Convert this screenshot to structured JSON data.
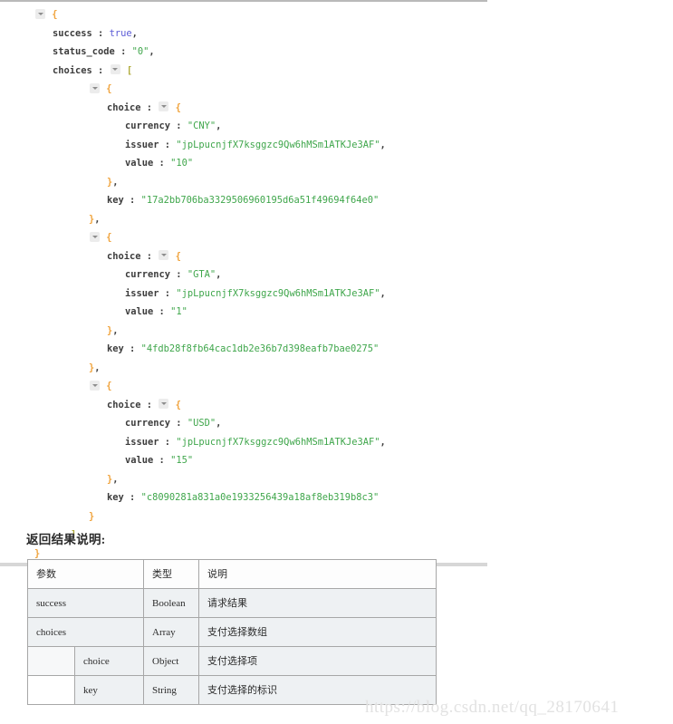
{
  "json_viewer": {
    "lines": [
      {
        "indent": 0,
        "toggle": true,
        "segments": [
          {
            "t": "brace",
            "v": "{"
          }
        ]
      },
      {
        "indent": 1,
        "toggle": false,
        "segments": [
          {
            "t": "k",
            "v": "success"
          },
          {
            "t": "colon",
            "v": " : "
          },
          {
            "t": "bool",
            "v": "true"
          },
          {
            "t": "punc",
            "v": ","
          }
        ]
      },
      {
        "indent": 1,
        "toggle": false,
        "segments": [
          {
            "t": "k",
            "v": "status_code"
          },
          {
            "t": "colon",
            "v": " : "
          },
          {
            "t": "str",
            "v": "\"0\""
          },
          {
            "t": "punc",
            "v": ","
          }
        ]
      },
      {
        "indent": 1,
        "toggle": false,
        "segments": [
          {
            "t": "k",
            "v": "choices"
          },
          {
            "t": "colon",
            "v": " : "
          },
          {
            "t": "tri"
          },
          {
            "t": "brack",
            "v": " ["
          }
        ]
      },
      {
        "indent": 3,
        "toggle": true,
        "segments": [
          {
            "t": "brace",
            "v": "{"
          }
        ]
      },
      {
        "indent": 4,
        "toggle": false,
        "segments": [
          {
            "t": "k",
            "v": "choice"
          },
          {
            "t": "colon",
            "v": " : "
          },
          {
            "t": "tri"
          },
          {
            "t": "brace",
            "v": " {"
          }
        ]
      },
      {
        "indent": 5,
        "toggle": false,
        "segments": [
          {
            "t": "k",
            "v": "currency"
          },
          {
            "t": "colon",
            "v": " : "
          },
          {
            "t": "str",
            "v": "\"CNY\""
          },
          {
            "t": "punc",
            "v": ","
          }
        ]
      },
      {
        "indent": 5,
        "toggle": false,
        "segments": [
          {
            "t": "k",
            "v": "issuer"
          },
          {
            "t": "colon",
            "v": " : "
          },
          {
            "t": "str",
            "v": "\"jpLpucnjfX7ksggzc9Qw6hMSm1ATKJe3AF\""
          },
          {
            "t": "punc",
            "v": ","
          }
        ]
      },
      {
        "indent": 5,
        "toggle": false,
        "segments": [
          {
            "t": "k",
            "v": "value"
          },
          {
            "t": "colon",
            "v": " : "
          },
          {
            "t": "str",
            "v": "\"10\""
          }
        ]
      },
      {
        "indent": 4,
        "toggle": false,
        "segments": [
          {
            "t": "brace",
            "v": "}"
          },
          {
            "t": "punc",
            "v": ","
          }
        ]
      },
      {
        "indent": 4,
        "toggle": false,
        "segments": [
          {
            "t": "k",
            "v": "key"
          },
          {
            "t": "colon",
            "v": " : "
          },
          {
            "t": "str",
            "v": "\"17a2bb706ba3329506960195d6a51f49694f64e0\""
          }
        ]
      },
      {
        "indent": 3,
        "toggle": false,
        "segments": [
          {
            "t": "brace",
            "v": "}"
          },
          {
            "t": "punc",
            "v": ","
          }
        ]
      },
      {
        "indent": 3,
        "toggle": true,
        "segments": [
          {
            "t": "brace",
            "v": "{"
          }
        ]
      },
      {
        "indent": 4,
        "toggle": false,
        "segments": [
          {
            "t": "k",
            "v": "choice"
          },
          {
            "t": "colon",
            "v": " : "
          },
          {
            "t": "tri"
          },
          {
            "t": "brace",
            "v": " {"
          }
        ]
      },
      {
        "indent": 5,
        "toggle": false,
        "segments": [
          {
            "t": "k",
            "v": "currency"
          },
          {
            "t": "colon",
            "v": " : "
          },
          {
            "t": "str",
            "v": "\"GTA\""
          },
          {
            "t": "punc",
            "v": ","
          }
        ]
      },
      {
        "indent": 5,
        "toggle": false,
        "segments": [
          {
            "t": "k",
            "v": "issuer"
          },
          {
            "t": "colon",
            "v": " : "
          },
          {
            "t": "str",
            "v": "\"jpLpucnjfX7ksggzc9Qw6hMSm1ATKJe3AF\""
          },
          {
            "t": "punc",
            "v": ","
          }
        ]
      },
      {
        "indent": 5,
        "toggle": false,
        "segments": [
          {
            "t": "k",
            "v": "value"
          },
          {
            "t": "colon",
            "v": " : "
          },
          {
            "t": "str",
            "v": "\"1\""
          }
        ]
      },
      {
        "indent": 4,
        "toggle": false,
        "segments": [
          {
            "t": "brace",
            "v": "}"
          },
          {
            "t": "punc",
            "v": ","
          }
        ]
      },
      {
        "indent": 4,
        "toggle": false,
        "segments": [
          {
            "t": "k",
            "v": "key"
          },
          {
            "t": "colon",
            "v": " : "
          },
          {
            "t": "str",
            "v": "\"4fdb28f8fb64cac1db2e36b7d398eafb7bae0275\""
          }
        ]
      },
      {
        "indent": 3,
        "toggle": false,
        "segments": [
          {
            "t": "brace",
            "v": "}"
          },
          {
            "t": "punc",
            "v": ","
          }
        ]
      },
      {
        "indent": 3,
        "toggle": true,
        "segments": [
          {
            "t": "brace",
            "v": "{"
          }
        ]
      },
      {
        "indent": 4,
        "toggle": false,
        "segments": [
          {
            "t": "k",
            "v": "choice"
          },
          {
            "t": "colon",
            "v": " : "
          },
          {
            "t": "tri"
          },
          {
            "t": "brace",
            "v": " {"
          }
        ]
      },
      {
        "indent": 5,
        "toggle": false,
        "segments": [
          {
            "t": "k",
            "v": "currency"
          },
          {
            "t": "colon",
            "v": " : "
          },
          {
            "t": "str",
            "v": "\"USD\""
          },
          {
            "t": "punc",
            "v": ","
          }
        ]
      },
      {
        "indent": 5,
        "toggle": false,
        "segments": [
          {
            "t": "k",
            "v": "issuer"
          },
          {
            "t": "colon",
            "v": " : "
          },
          {
            "t": "str",
            "v": "\"jpLpucnjfX7ksggzc9Qw6hMSm1ATKJe3AF\""
          },
          {
            "t": "punc",
            "v": ","
          }
        ]
      },
      {
        "indent": 5,
        "toggle": false,
        "segments": [
          {
            "t": "k",
            "v": "value"
          },
          {
            "t": "colon",
            "v": " : "
          },
          {
            "t": "str",
            "v": "\"15\""
          }
        ]
      },
      {
        "indent": 4,
        "toggle": false,
        "segments": [
          {
            "t": "brace",
            "v": "}"
          },
          {
            "t": "punc",
            "v": ","
          }
        ]
      },
      {
        "indent": 4,
        "toggle": false,
        "segments": [
          {
            "t": "k",
            "v": "key"
          },
          {
            "t": "colon",
            "v": " : "
          },
          {
            "t": "str",
            "v": "\"c8090281a831a0e1933256439a18af8eb319b8c3\""
          }
        ]
      },
      {
        "indent": 3,
        "toggle": false,
        "segments": [
          {
            "t": "brace",
            "v": "}"
          }
        ]
      },
      {
        "indent": 2,
        "toggle": false,
        "segments": [
          {
            "t": "brack",
            "v": "]"
          }
        ]
      },
      {
        "indent": 0,
        "toggle": false,
        "segments": [
          {
            "t": "brace",
            "v": "}"
          }
        ]
      }
    ],
    "colors": {
      "string": "#3fa64b",
      "boolean": "#5b5bd6",
      "brace": "#f0a33c",
      "bracket": "#b0ab3a",
      "key": "#3c3c3c"
    }
  },
  "description": {
    "heading": "返回结果说明:"
  },
  "table": {
    "headers": [
      "参数",
      "",
      "类型",
      "说明"
    ],
    "rows": [
      {
        "name": "success",
        "sub": "",
        "type": "Boolean",
        "desc": "请求结果",
        "nested": false
      },
      {
        "name": "choices",
        "sub": "",
        "type": "Array",
        "desc": "支付选择数组",
        "nested": false
      },
      {
        "name": "",
        "sub": "choice",
        "type": "Object",
        "desc": "支付选择项",
        "nested": true
      },
      {
        "name": "",
        "sub": "key",
        "type": "String",
        "desc": "支付选择的标识",
        "nested": true
      }
    ]
  },
  "watermark": {
    "text": "https://blog.csdn.net/qq_28170641"
  }
}
